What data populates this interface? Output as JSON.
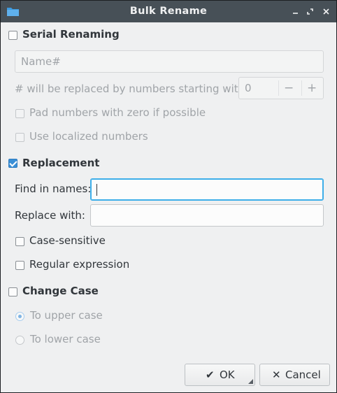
{
  "window": {
    "title": "Bulk Rename"
  },
  "serial": {
    "label": "Serial Renaming",
    "checked": false,
    "name_placeholder": "Name#",
    "start_label": "# will be replaced by numbers starting with:",
    "start_value": "0",
    "pad_label": "Pad numbers with zero if possible",
    "localized_label": "Use localized numbers"
  },
  "replacement": {
    "label": "Replacement",
    "checked": true,
    "find_label": "Find in names:",
    "find_value": "",
    "replace_label": "Replace with:",
    "replace_value": "",
    "case_sensitive_label": "Case-sensitive",
    "regex_label": "Regular expression"
  },
  "change_case": {
    "label": "Change Case",
    "checked": false,
    "upper_label": "To upper case",
    "lower_label": "To lower case",
    "selected": "To upper case"
  },
  "buttons": {
    "ok_icon": "✔",
    "ok_label": "OK",
    "cancel_icon": "✕",
    "cancel_label": "Cancel"
  },
  "icons": {
    "app": "folder-icon",
    "minimize": "minimize-icon",
    "maximize": "maximize-icon",
    "close": "close-icon"
  },
  "colors": {
    "titlebar": "#475057",
    "accent": "#3daee9",
    "checkbox_checked": "#3a8fd6",
    "background": "#eff0f1"
  }
}
